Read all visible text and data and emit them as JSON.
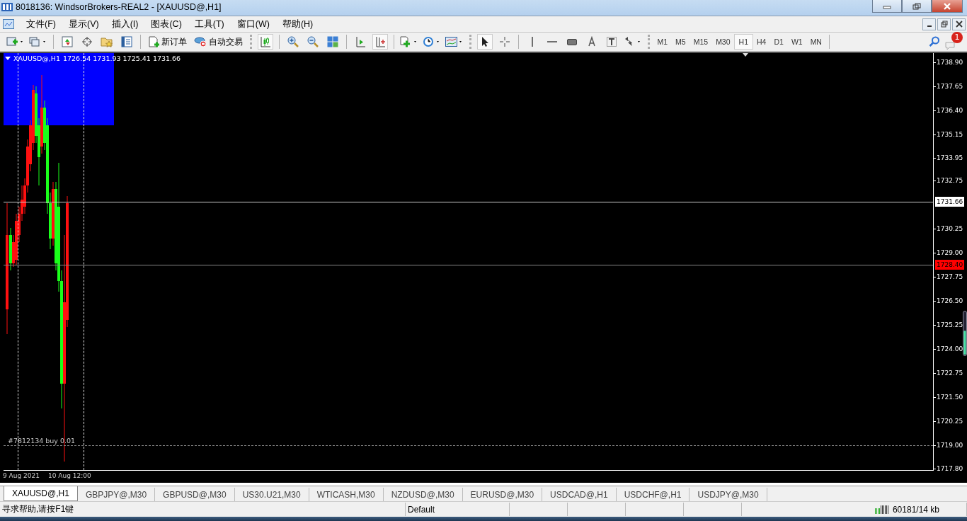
{
  "window": {
    "title": "8018136: WindsorBrokers-REAL2 - [XAUUSD@,H1]"
  },
  "menu": [
    "文件(F)",
    "显示(V)",
    "插入(I)",
    "图表(C)",
    "工具(T)",
    "窗口(W)",
    "帮助(H)"
  ],
  "toolbar": {
    "new_order": "新订单",
    "auto_trading": "自动交易"
  },
  "timeframes": [
    {
      "label": "M1",
      "selected": false
    },
    {
      "label": "M5",
      "selected": false
    },
    {
      "label": "M15",
      "selected": false
    },
    {
      "label": "M30",
      "selected": false
    },
    {
      "label": "H1",
      "selected": true
    },
    {
      "label": "H4",
      "selected": false
    },
    {
      "label": "D1",
      "selected": false
    },
    {
      "label": "W1",
      "selected": false
    },
    {
      "label": "MN",
      "selected": false
    }
  ],
  "notifications": {
    "count": "1"
  },
  "chart": {
    "symbol": "XAUUSD@,H1",
    "ohlc": "1726.54 1731.93 1725.41 1731.66",
    "price_axis": [
      "1738.90",
      "1737.65",
      "1736.40",
      "1735.15",
      "1733.95",
      "1732.75",
      "1730.25",
      "1729.00",
      "1727.75",
      "1726.50",
      "1725.25",
      "1724.00",
      "1722.75",
      "1721.50",
      "1720.25",
      "1719.00",
      "1717.80"
    ],
    "bid_label": "1731.66",
    "ask_label": "1728.40",
    "order_label": "#7812134 buy 0.01",
    "time_axis": [
      "9 Aug 2021",
      "10 Aug 12:00"
    ]
  },
  "tabs": [
    {
      "label": "XAUUSD@,H1",
      "selected": true
    },
    {
      "label": "GBPJPY@,M30",
      "selected": false
    },
    {
      "label": "GBPUSD@,M30",
      "selected": false
    },
    {
      "label": "US30.U21,M30",
      "selected": false
    },
    {
      "label": "WTICASH,M30",
      "selected": false
    },
    {
      "label": "NZDUSD@,M30",
      "selected": false
    },
    {
      "label": "EURUSD@,M30",
      "selected": false
    },
    {
      "label": "USDCAD@,H1",
      "selected": false
    },
    {
      "label": "USDCHF@,H1",
      "selected": false
    },
    {
      "label": "USDJPY@,M30",
      "selected": false
    }
  ],
  "status_bar": {
    "help": "寻求帮助,请按F1键",
    "profile": "Default",
    "traffic": "60181/14 kb"
  }
}
